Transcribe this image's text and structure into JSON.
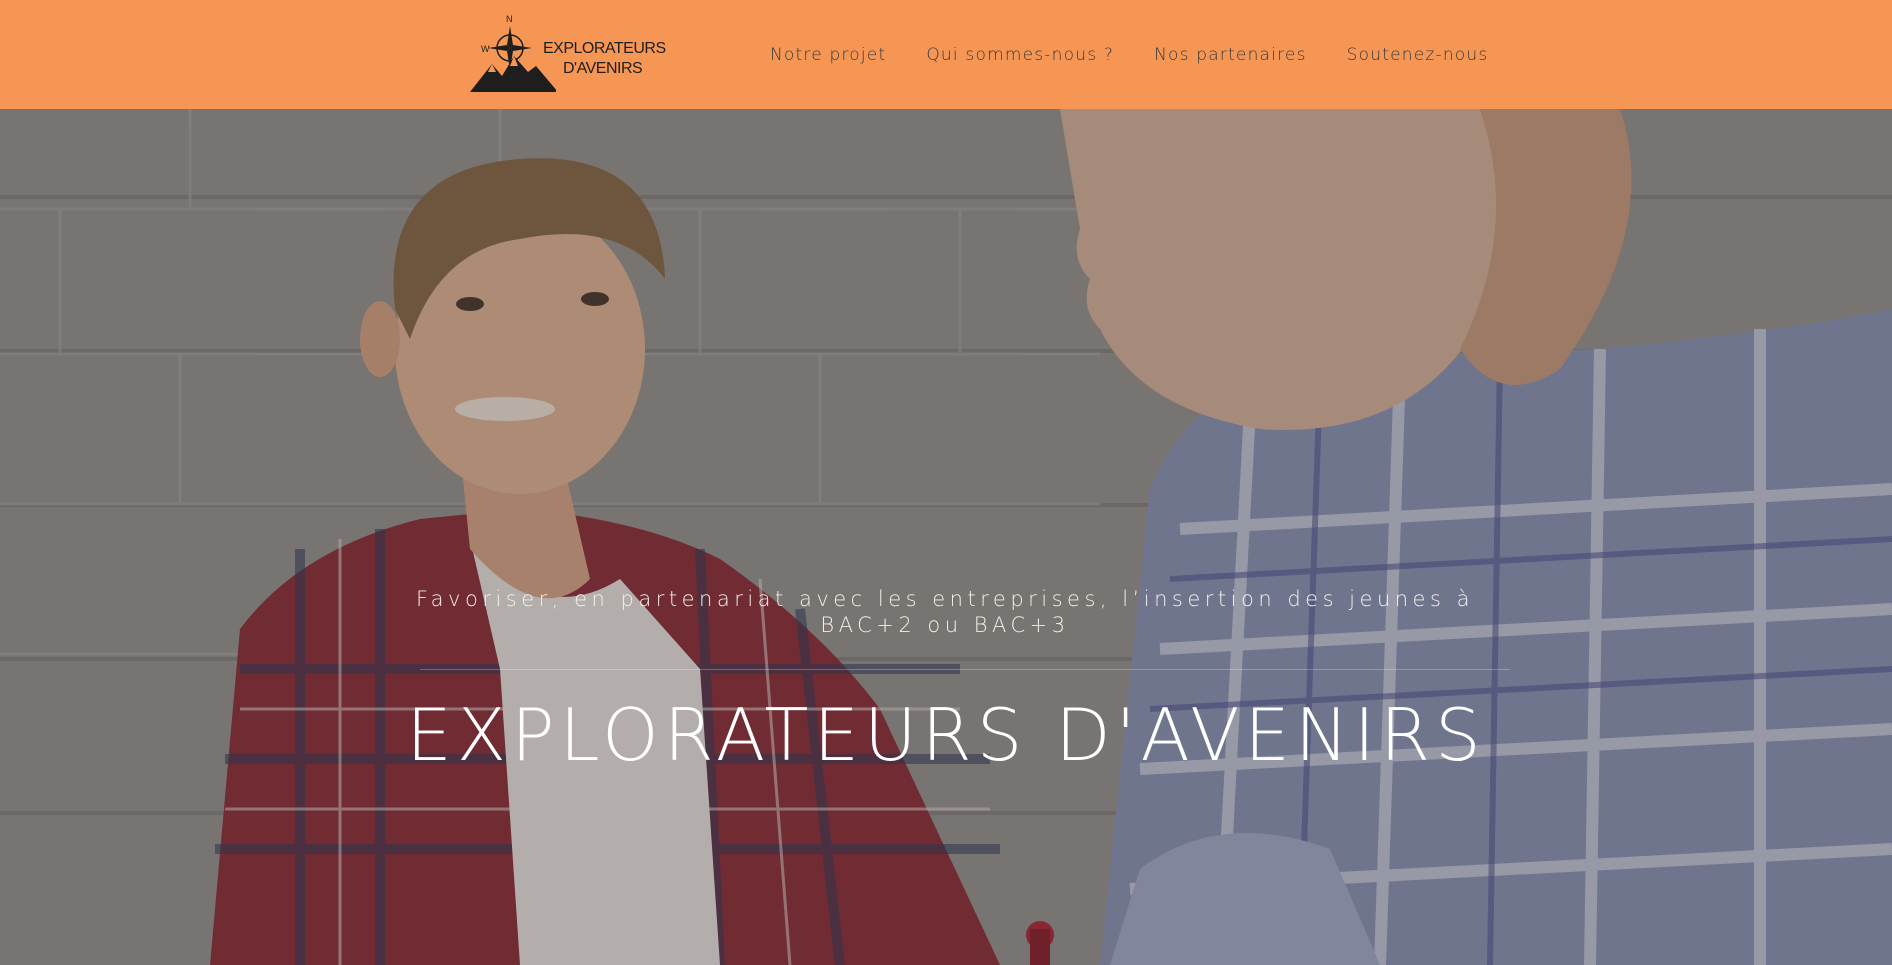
{
  "header": {
    "logo": {
      "line1": "EXPLORATEURS",
      "line2": "D'AVENIRS",
      "compass_n": "N",
      "compass_w": "W"
    },
    "nav": [
      {
        "label": "Notre projet"
      },
      {
        "label": "Qui sommes-nous ?"
      },
      {
        "label": "Nos partenaires"
      },
      {
        "label": "Soutenez-nous"
      }
    ],
    "background_color": "#f59655"
  },
  "hero": {
    "tagline": "Favoriser, en partenariat avec les entreprises, l’insertion des jeunes à BAC+2 ou BAC+3",
    "title": "EXPLORATEURS D'AVENIRS",
    "photo": "two-men-conversation-photo"
  }
}
